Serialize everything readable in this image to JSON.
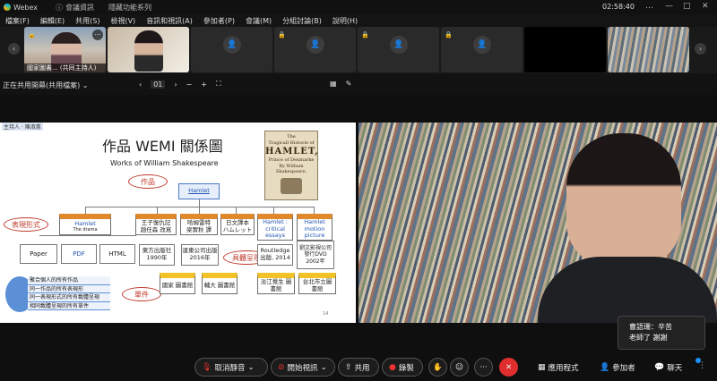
{
  "titlebar": {
    "app": "Webex",
    "meeting_info": "會議資訊",
    "meeting_title": "隱藏功能系列",
    "clock": "02:58:40",
    "more": "…",
    "minimize": "—",
    "maximize": "□",
    "close": "✕"
  },
  "menu": [
    "檔案(F)",
    "編輯(E)",
    "共用(S)",
    "檢視(V)",
    "音訊和視訊(A)",
    "參加者(P)",
    "會議(M)",
    "分組討論(B)",
    "說明(H)"
  ],
  "strip": {
    "prev": "‹",
    "next": "›",
    "host_name": "國家圖書... (共同主持人)",
    "more_label": "···"
  },
  "share": {
    "label": "正在共用開幕(共用檔案)",
    "page_num": "01",
    "zoom_out": "−",
    "zoom_in": "+"
  },
  "slide": {
    "owner": "主持人 · 陳淑惠",
    "title": "作品 WEMI 關係圖",
    "subtitle": "Works of William Shakespeare",
    "book": {
      "line1": "The",
      "line2": "Tragicall Historie of",
      "line3": "HAMLET,",
      "line4": "Prince of Denmarke",
      "line5": "By William Shakespeare."
    },
    "label_work": "作品",
    "label_expression": "表現形式",
    "label_manifestation": "具體呈現",
    "label_item": "單件",
    "work_node": "Hamlet",
    "expressions": [
      {
        "title": "Hamlet",
        "sub": "The drama"
      },
      {
        "title": "王子復仇記",
        "sub": "趙任森 改寫"
      },
      {
        "title": "哈姆雷特",
        "sub": "梁實秋 譯"
      },
      {
        "title": "日文譯本",
        "sub": "ハムレット"
      },
      {
        "title": "Hamlet :",
        "sub": "critical essays"
      },
      {
        "title": "Hamlet",
        "sub": "motion picture"
      }
    ],
    "manifestations": [
      "Paper",
      "PDF",
      "HTML",
      "東方出版社 1990年",
      "遠東公司出版 2016年",
      "Routledge 出版, 2014",
      "劉文影視公司發行DVD 2002年"
    ],
    "items": [
      "國家 圖書館",
      "輔大 圖書館",
      "淡江覺生 圖書館",
      "台北市立圖 書館"
    ],
    "legend": [
      "聚合個人的所有作品",
      "同一作品的所有表現形",
      "同一表現形式的所有載體呈現",
      "相同載體呈現的所有單件"
    ],
    "page_no": "14"
  },
  "chat_popup": {
    "sender": "曹語珊：辛苦",
    "message": "老師了 謝謝"
  },
  "toolbar": {
    "unmute": "取消靜音",
    "start_video": "開始視訊",
    "share": "共用",
    "record": "錄製",
    "apps": "應用程式",
    "participants": "參加者",
    "chat": "聊天",
    "more": "···",
    "end": "✕"
  }
}
